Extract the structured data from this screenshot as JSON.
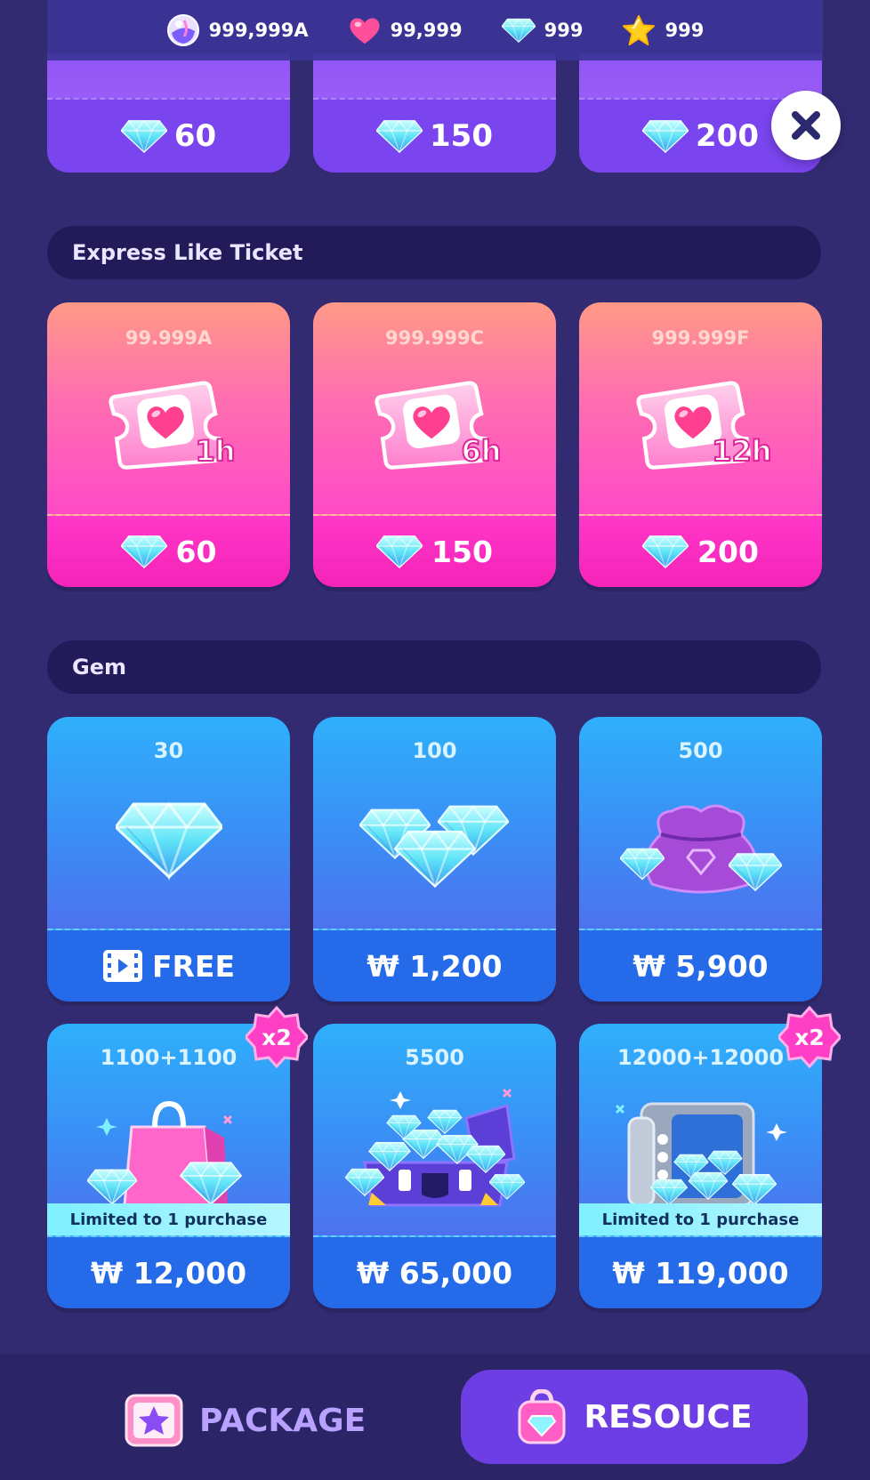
{
  "currencies": [
    {
      "icon": "potion-orb-icon",
      "value": "999,999A"
    },
    {
      "icon": "heart-icon",
      "value": "99,999"
    },
    {
      "icon": "gem-icon",
      "value": "999"
    },
    {
      "icon": "star-icon",
      "value": "999"
    }
  ],
  "top_row": {
    "prices": [
      "60",
      "150",
      "200"
    ]
  },
  "express_like": {
    "title": "Express Like Ticket",
    "items": [
      {
        "amount": "99.999A",
        "duration": "1h",
        "price": "60"
      },
      {
        "amount": "999.999C",
        "duration": "6h",
        "price": "150"
      },
      {
        "amount": "999.999F",
        "duration": "12h",
        "price": "200"
      }
    ]
  },
  "gem": {
    "title": "Gem",
    "items": [
      {
        "amount": "30",
        "price": "FREE",
        "icon": "video-icon"
      },
      {
        "amount": "100",
        "price": "₩ 1,200"
      },
      {
        "amount": "500",
        "price": "₩ 5,900"
      },
      {
        "amount": "1100+1100",
        "price": "₩ 12,000",
        "badge": "x2",
        "limited": "Limited to 1 purchase"
      },
      {
        "amount": "5500",
        "price": "₩ 65,000"
      },
      {
        "amount": "12000+12000",
        "price": "₩ 119,000",
        "badge": "x2",
        "limited": "Limited to 1 purchase"
      }
    ]
  },
  "nav": {
    "package": "PACKAGE",
    "resource": "RESOUCE"
  },
  "colors": {
    "background": "#322b72",
    "pink_button": "#f523b9",
    "blue_button": "#256ae8",
    "nav_active": "#6c3ee4"
  }
}
